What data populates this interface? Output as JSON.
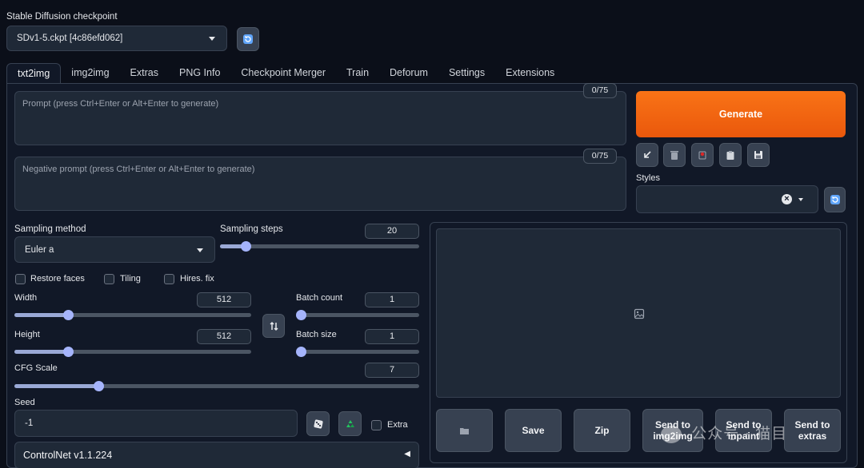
{
  "checkpoint": {
    "label": "Stable Diffusion checkpoint",
    "value": "SDv1-5.ckpt [4c86efd062]"
  },
  "tabs": [
    "txt2img",
    "img2img",
    "Extras",
    "PNG Info",
    "Checkpoint Merger",
    "Train",
    "Deforum",
    "Settings",
    "Extensions"
  ],
  "prompt": {
    "placeholder": "Prompt (press Ctrl+Enter or Alt+Enter to generate)",
    "counter": "0/75"
  },
  "negative_prompt": {
    "placeholder": "Negative prompt (press Ctrl+Enter or Alt+Enter to generate)",
    "counter": "0/75"
  },
  "generate_label": "Generate",
  "styles": {
    "label": "Styles",
    "clear_icon": "×"
  },
  "sampling": {
    "method_label": "Sampling method",
    "method_value": "Euler a",
    "steps_label": "Sampling steps",
    "steps_value": "20"
  },
  "options": {
    "restore_faces": "Restore faces",
    "tiling": "Tiling",
    "hires_fix": "Hires. fix"
  },
  "width": {
    "label": "Width",
    "value": "512"
  },
  "height": {
    "label": "Height",
    "value": "512"
  },
  "batch_count": {
    "label": "Batch count",
    "value": "1"
  },
  "batch_size": {
    "label": "Batch size",
    "value": "1"
  },
  "cfg": {
    "label": "CFG Scale",
    "value": "7"
  },
  "seed": {
    "label": "Seed",
    "value": "-1",
    "extra_label": "Extra"
  },
  "output_buttons": {
    "save": "Save",
    "zip": "Zip",
    "send_img2img": "Send to img2img",
    "send_inpaint": "Send to inpaint",
    "send_extras": "Send to extras"
  },
  "controlnet": {
    "title": "ControlNet v1.1.224",
    "toggle_icon": "◀"
  },
  "watermark": {
    "text": "公众号 · 猫目"
  },
  "sliders": {
    "sampling_steps": {
      "value": 20,
      "min": 1,
      "max": 150
    },
    "width": {
      "value": 512,
      "min": 64,
      "max": 2048
    },
    "height": {
      "value": 512,
      "min": 64,
      "max": 2048
    },
    "batch_count": {
      "value": 1,
      "min": 1,
      "max": 100
    },
    "batch_size": {
      "value": 1,
      "min": 1,
      "max": 8
    },
    "cfg": {
      "value": 7,
      "min": 1,
      "max": 30
    }
  }
}
